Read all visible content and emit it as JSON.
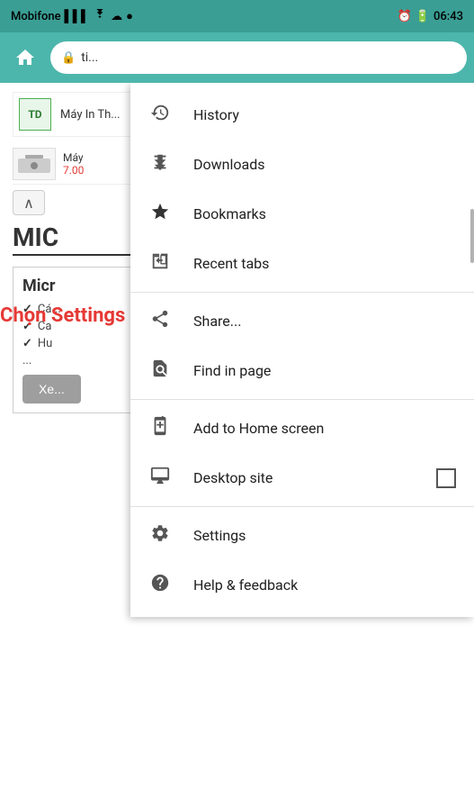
{
  "statusBar": {
    "carrier": "Mobifone",
    "signal": "▌▌▌",
    "wifi": "WiFi",
    "cloud": "☁",
    "profile": "●",
    "time": "06:43"
  },
  "browser": {
    "addressText": "ti...",
    "homeLabel": "⌂"
  },
  "page": {
    "adBrand": "TD",
    "adTitle": "Máy In Th...",
    "productTitle": "Máy",
    "productPrice": "7.00",
    "headingText": "MIC",
    "sectionTitle": "Micr",
    "checkItems": [
      "Cá...",
      "Ca",
      "Hu"
    ],
    "ellipsis": "...",
    "btnLabel": "Xe..."
  },
  "instruction": {
    "text": "Chọn Settings (Cài đặt)"
  },
  "menu": {
    "items": [
      {
        "id": "history",
        "icon": "history",
        "label": "History",
        "hasCheckbox": false
      },
      {
        "id": "downloads",
        "icon": "download",
        "label": "Downloads",
        "hasCheckbox": false
      },
      {
        "id": "bookmarks",
        "icon": "star",
        "label": "Bookmarks",
        "hasCheckbox": false
      },
      {
        "id": "recent-tabs",
        "icon": "tabs",
        "label": "Recent tabs",
        "hasCheckbox": false
      }
    ],
    "divider1": true,
    "items2": [
      {
        "id": "share",
        "icon": "share",
        "label": "Share...",
        "hasCheckbox": false
      },
      {
        "id": "find-in-page",
        "icon": "search-page",
        "label": "Find in page",
        "hasCheckbox": false
      }
    ],
    "divider2": true,
    "items3": [
      {
        "id": "add-home",
        "icon": "add-home",
        "label": "Add to Home screen",
        "hasCheckbox": false
      },
      {
        "id": "desktop-site",
        "icon": "desktop",
        "label": "Desktop site",
        "hasCheckbox": true
      }
    ],
    "divider3": true,
    "items4": [
      {
        "id": "settings",
        "icon": "settings",
        "label": "Settings",
        "hasCheckbox": false
      },
      {
        "id": "help",
        "icon": "help",
        "label": "Help & feedback",
        "hasCheckbox": false
      }
    ]
  }
}
